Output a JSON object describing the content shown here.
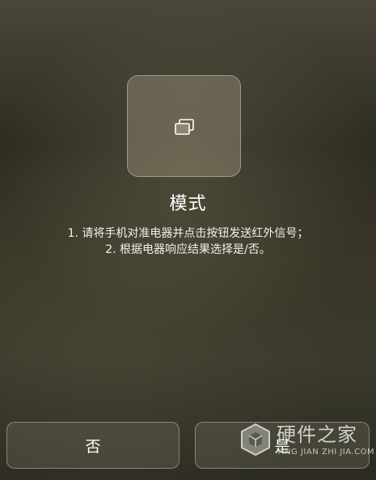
{
  "mode_card": {
    "icon": "copy-windows-icon"
  },
  "title": "模式",
  "instructions": [
    "1. 请将手机对准电器并点击按钮发送红外信号；",
    "2. 根据电器响应结果选择是/否。"
  ],
  "buttons": {
    "no_label": "否",
    "yes_label": "是"
  },
  "watermark": {
    "text": "硬件之家",
    "subtext": "YING JIAN ZHI JIA.COM",
    "icon": "hexagon-logo-icon"
  }
}
